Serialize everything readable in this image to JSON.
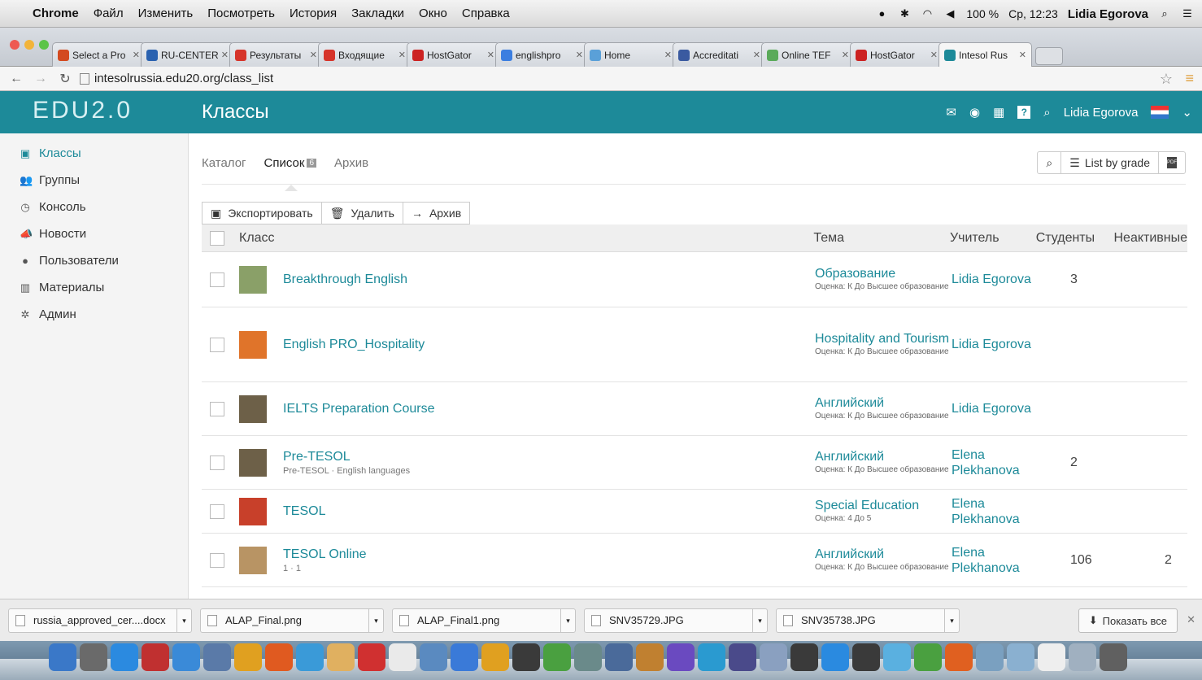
{
  "menubar": {
    "app": "Chrome",
    "items": [
      "Файл",
      "Изменить",
      "Посмотреть",
      "История",
      "Закладки",
      "Окно",
      "Справка"
    ],
    "battery": "100 %",
    "clock": "Ср, 12:23",
    "user": "Lidia Egorova"
  },
  "tabs": [
    {
      "label": "Select a Pro",
      "color": "#d34a1f"
    },
    {
      "label": "RU-CENTER",
      "color": "#2a62b0"
    },
    {
      "label": "Результаты",
      "color": "#d6342a"
    },
    {
      "label": "Входящие",
      "color": "#d6342a"
    },
    {
      "label": "HostGator",
      "color": "#c22"
    },
    {
      "label": "englishpro",
      "color": "#3b7ee0"
    },
    {
      "label": "Home",
      "color": "#5aa0d8"
    },
    {
      "label": "Accreditati",
      "color": "#3a5aa0"
    },
    {
      "label": "Online TEF",
      "color": "#5aaa5a"
    },
    {
      "label": "HostGator",
      "color": "#c22"
    },
    {
      "label": "Intesol Rus",
      "color": "#1d8a99"
    }
  ],
  "address": {
    "url": "intesolrussia.edu20.org/class_list"
  },
  "header": {
    "logo": "EDU2.0",
    "title": "Классы",
    "user": "Lidia Egorova"
  },
  "sidebar": {
    "items": [
      {
        "label": "Классы",
        "icon": "▣",
        "active": true
      },
      {
        "label": "Группы",
        "icon": "👥",
        "active": false
      },
      {
        "label": "Консоль",
        "icon": "◷",
        "active": false
      },
      {
        "label": "Новости",
        "icon": "📣",
        "active": false
      },
      {
        "label": "Пользователи",
        "icon": "●",
        "active": false
      },
      {
        "label": "Материалы",
        "icon": "▥",
        "active": false
      },
      {
        "label": "Админ",
        "icon": "✲",
        "active": false
      }
    ]
  },
  "subtabs": {
    "catalog": "Каталог",
    "list": "Список",
    "list_count": "6",
    "archive": "Архив"
  },
  "right_tools": {
    "list_by": "List by grade"
  },
  "actions": {
    "export": "Экспортировать",
    "delete": "Удалить",
    "archive": "Архив"
  },
  "table": {
    "headers": {
      "class": "Класс",
      "topic": "Тема",
      "teacher": "Учитель",
      "students": "Студенты",
      "inactive": "Неактивные"
    },
    "rows": [
      {
        "name": "Breakthrough English",
        "sub": "",
        "topic": "Образование",
        "topic_sub": "Оценка: К До Высшее образование",
        "teacher": "Lidia Egorova",
        "students": "3",
        "inactive": "",
        "thumb": "#8aa068",
        "height": 68
      },
      {
        "name": "English PRO_Hospitality",
        "sub": "",
        "topic": "Hospitality and Tourism",
        "topic_sub": "Оценка: К До Высшее образование",
        "teacher": "Lidia Egorova",
        "students": "",
        "inactive": "",
        "thumb": "#e0742a",
        "height": 92
      },
      {
        "name": "IELTS Preparation Course",
        "sub": "",
        "topic": "Английский",
        "topic_sub": "Оценка: К До Высшее образование",
        "teacher": "Lidia Egorova",
        "students": "",
        "inactive": "",
        "thumb": "#6d6048",
        "height": 66
      },
      {
        "name": "Pre-TESOL",
        "sub": "Pre-TESOL · English languages",
        "topic": "Английский",
        "topic_sub": "Оценка: К До Высшее образование",
        "teacher": "Elena Plekhanova",
        "students": "2",
        "inactive": "",
        "thumb": "#6d6048",
        "height": 66
      },
      {
        "name": "TESOL",
        "sub": "",
        "topic": "Special Education",
        "topic_sub": "Оценка: 4 До 5",
        "teacher": "Elena Plekhanova",
        "students": "",
        "inactive": "",
        "thumb": "#c8402a",
        "height": 54
      },
      {
        "name": "TESOL Online",
        "sub": "1 · 1",
        "topic": "Английский",
        "topic_sub": "Оценка: К До Высшее образование",
        "teacher": "Elena Plekhanova",
        "students": "106",
        "inactive": "2",
        "thumb": "#b89464",
        "height": 66
      }
    ]
  },
  "downloads": {
    "files": [
      "russia_approved_cer....docx",
      "ALAP_Final.png",
      "ALAP_Final1.png",
      "SNV35729.JPG",
      "SNV35738.JPG"
    ],
    "show_all": "Показать все"
  },
  "colors": {
    "brand": "#1d8a99"
  }
}
